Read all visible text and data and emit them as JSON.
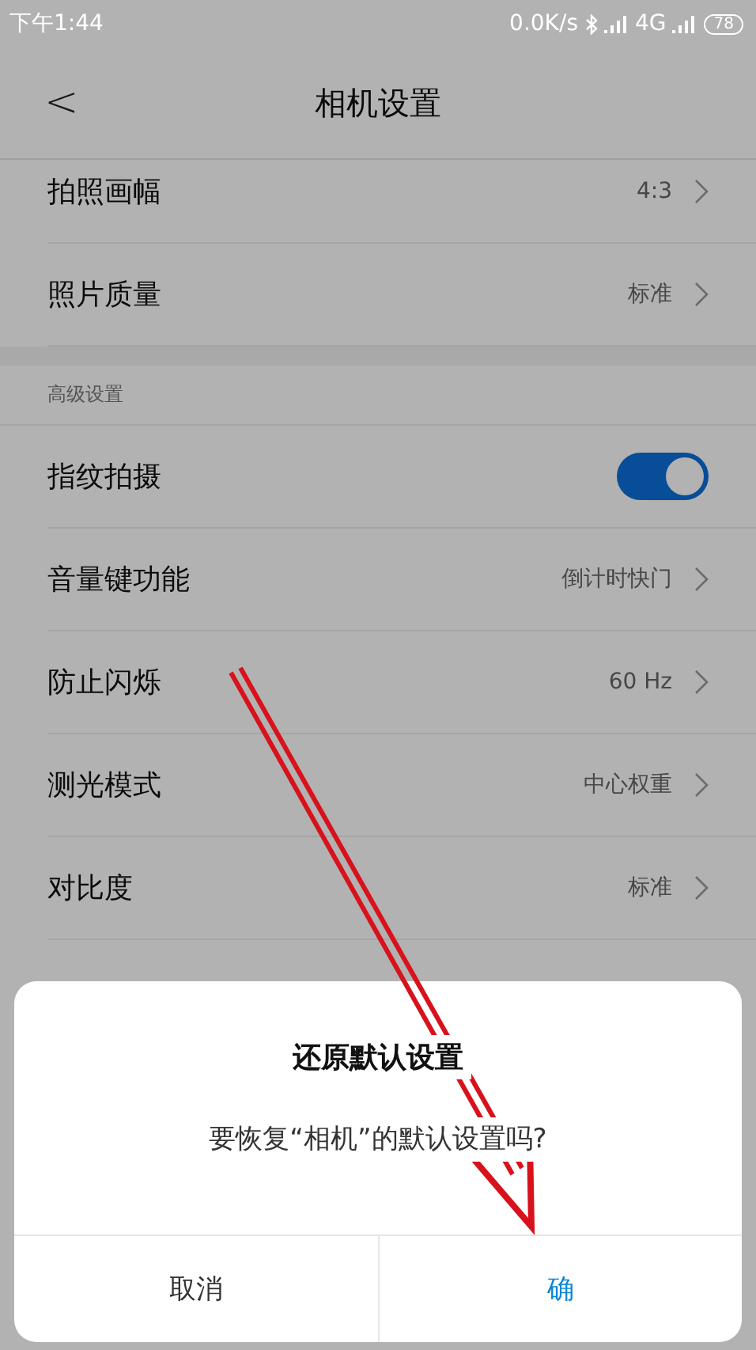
{
  "status_bar": {
    "time": "下午1:44",
    "speed": "0.0K/s",
    "network": "4G",
    "battery": "78"
  },
  "header": {
    "back": "<",
    "title": "相机设置"
  },
  "sections": [
    {
      "items": [
        {
          "kind": "link",
          "label": "拍照画幅",
          "value": "4:3"
        },
        {
          "kind": "link",
          "label": "照片质量",
          "value": "标准"
        }
      ]
    },
    {
      "title": "高级设置",
      "items": [
        {
          "kind": "switch",
          "label": "指纹拍摄",
          "on": true
        },
        {
          "kind": "link",
          "label": "音量键功能",
          "value": "倒计时快门"
        },
        {
          "kind": "link",
          "label": "防止闪烁",
          "value": "60 Hz"
        },
        {
          "kind": "link",
          "label": "测光模式",
          "value": "中心权重"
        },
        {
          "kind": "link",
          "label": "对比度",
          "value": "标准"
        }
      ]
    }
  ],
  "dialog": {
    "title": "还原默认设置",
    "message": "要恢复“相机”的默认设置吗?",
    "buttons": [
      {
        "kind": "cancel",
        "label": "取消"
      },
      {
        "kind": "confirm",
        "label": "确"
      }
    ]
  }
}
